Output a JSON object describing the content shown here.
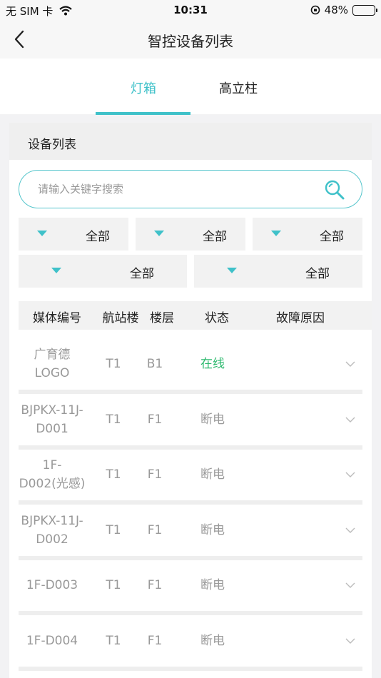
{
  "status_bar": {
    "carrier": "无 SIM 卡",
    "time": "10:31",
    "battery": "48%",
    "battery_level": 0.48
  },
  "nav": {
    "title": "智控设备列表"
  },
  "tabs": [
    {
      "label": "灯箱",
      "active": true
    },
    {
      "label": "高立柱",
      "active": false
    }
  ],
  "section": {
    "title": "设备列表"
  },
  "search": {
    "placeholder": "请输入关键字搜索",
    "value": ""
  },
  "filters": [
    {
      "label": "全部"
    },
    {
      "label": "全部"
    },
    {
      "label": "全部"
    },
    {
      "label": "全部"
    },
    {
      "label": "全部"
    }
  ],
  "table": {
    "headers": [
      "媒体编号",
      "航站楼",
      "楼层",
      "状态",
      "故障原因"
    ],
    "rows": [
      {
        "media_id": "广育德LOGO",
        "terminal": "T1",
        "floor": "B1",
        "status": "在线",
        "online": true,
        "reason": ""
      },
      {
        "media_id": "BJPKX-11J-D001",
        "terminal": "T1",
        "floor": "F1",
        "status": "断电",
        "online": false,
        "reason": ""
      },
      {
        "media_id": "1F-D002(光感)",
        "terminal": "T1",
        "floor": "F1",
        "status": "断电",
        "online": false,
        "reason": ""
      },
      {
        "media_id": "BJPKX-11J-D002",
        "terminal": "T1",
        "floor": "F1",
        "status": "断电",
        "online": false,
        "reason": ""
      },
      {
        "media_id": "1F-D003",
        "terminal": "T1",
        "floor": "F1",
        "status": "断电",
        "online": false,
        "reason": ""
      },
      {
        "media_id": "1F-D004",
        "terminal": "T1",
        "floor": "F1",
        "status": "断电",
        "online": false,
        "reason": ""
      }
    ]
  },
  "colors": {
    "accent": "#3fc1c9",
    "online": "#2db96e",
    "muted": "#999999"
  },
  "icons": {
    "back": "chevron-left-icon",
    "search": "search-icon",
    "filter": "triangle-down-icon",
    "row_expand": "chevron-down-icon"
  }
}
